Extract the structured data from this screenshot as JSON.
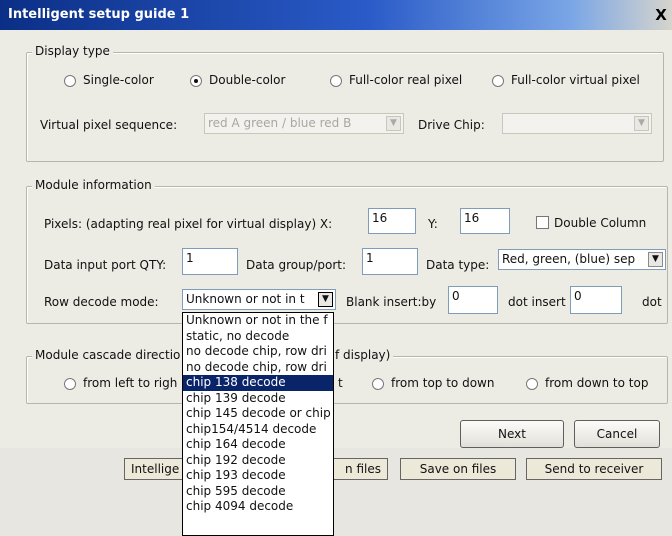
{
  "window": {
    "title": "Intelligent setup guide 1",
    "close_glyph": "X"
  },
  "display_type": {
    "legend": "Display type",
    "options": [
      "Single-color",
      "Double-color",
      "Full-color real pixel",
      "Full-color virtual pixel"
    ],
    "selected": "Double-color",
    "virtual_pixel_label": "Virtual pixel sequence:",
    "virtual_pixel_value": "red A green / blue red B",
    "drive_chip_label": "Drive Chip:",
    "drive_chip_value": ""
  },
  "module_info": {
    "legend": "Module information",
    "pixels_label": "Pixels: (adapting real pixel for virtual display) X:",
    "x_value": "16",
    "y_label": "Y:",
    "y_value": "16",
    "double_column_label": "Double Column",
    "double_column_checked": false,
    "data_input_label": "Data input port QTY:",
    "data_input_value": "1",
    "data_group_label": "Data group/port:",
    "data_group_value": "1",
    "data_type_label": "Data type:",
    "data_type_value": "Red, green, (blue) sep",
    "row_decode_label": "Row decode mode:",
    "row_decode_value": "Unknown or not in t",
    "blank_insert_label": "Blank insert:by",
    "blank_insert_value": "0",
    "dot_insert_label": "dot insert",
    "dot_insert_value": "0",
    "dot_trailing": "dot"
  },
  "cascade": {
    "legend_start": "Module cascade directio",
    "legend_end": "f display)",
    "opt_left_to_right": "from left to righ",
    "opt_right_fragment": "t",
    "opt_top_to_down": "from top to down",
    "opt_down_to_top": "from down to top"
  },
  "buttons": {
    "next": "Next",
    "cancel": "Cancel"
  },
  "background_buttons": [
    "Intellige",
    "n files",
    "Save on files",
    "Send to receiver"
  ],
  "row_decode_options": [
    "Unknown or not in the f",
    "static, no decode",
    "no decode chip, row dri",
    "no decode chip, row dri",
    "chip 138 decode",
    "chip 139 decode",
    "chip 145 decode or chip",
    "chip154/4514 decode",
    "chip 164 decode",
    "chip 192 decode",
    "chip 193 decode",
    "chip 595 decode",
    "chip 4094 decode"
  ],
  "row_decode_highlighted": "chip 138 decode",
  "colors": {
    "title_bar": "#0b2f86",
    "selection": "#0a246a",
    "dialog_bg": "#ecebe4"
  },
  "icons": {
    "dropdown": "chevron-down-icon",
    "close": "close-icon"
  }
}
